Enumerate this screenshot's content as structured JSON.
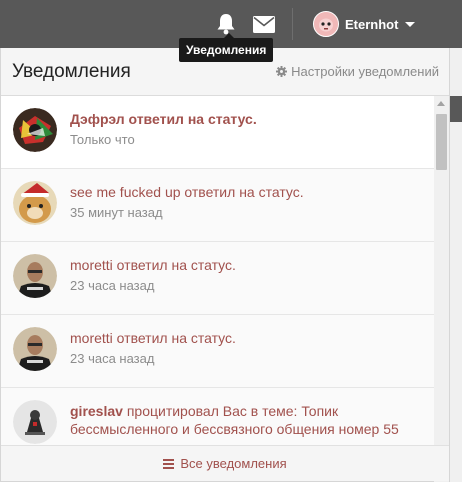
{
  "navbar": {
    "user_name": "Eternhot",
    "icons": [
      "bell-icon",
      "envelope-icon"
    ]
  },
  "tooltip": {
    "text": "Уведомления"
  },
  "panel": {
    "title": "Уведомления",
    "settings_label": "Настройки уведомлений",
    "footer_label": "Все уведомления"
  },
  "notifications": [
    {
      "name": "Дэфрэл",
      "action": " ответил на статус.",
      "time": "Только что"
    },
    {
      "name": "see me fucked up",
      "action": " ответил на статус.",
      "time": "35 минут назад"
    },
    {
      "name": "moretti",
      "action": " ответил на статус.",
      "time": "23 часа назад"
    },
    {
      "name": "moretti",
      "action": " ответил на статус.",
      "time": "23 часа назад"
    },
    {
      "name": "gireslav",
      "action": " процитировал Вас в теме: Топик бессмысленного и бессвязного общения номер 55",
      "time": ""
    }
  ],
  "colors": {
    "link": "#a1514d",
    "navbar": "#585858"
  }
}
